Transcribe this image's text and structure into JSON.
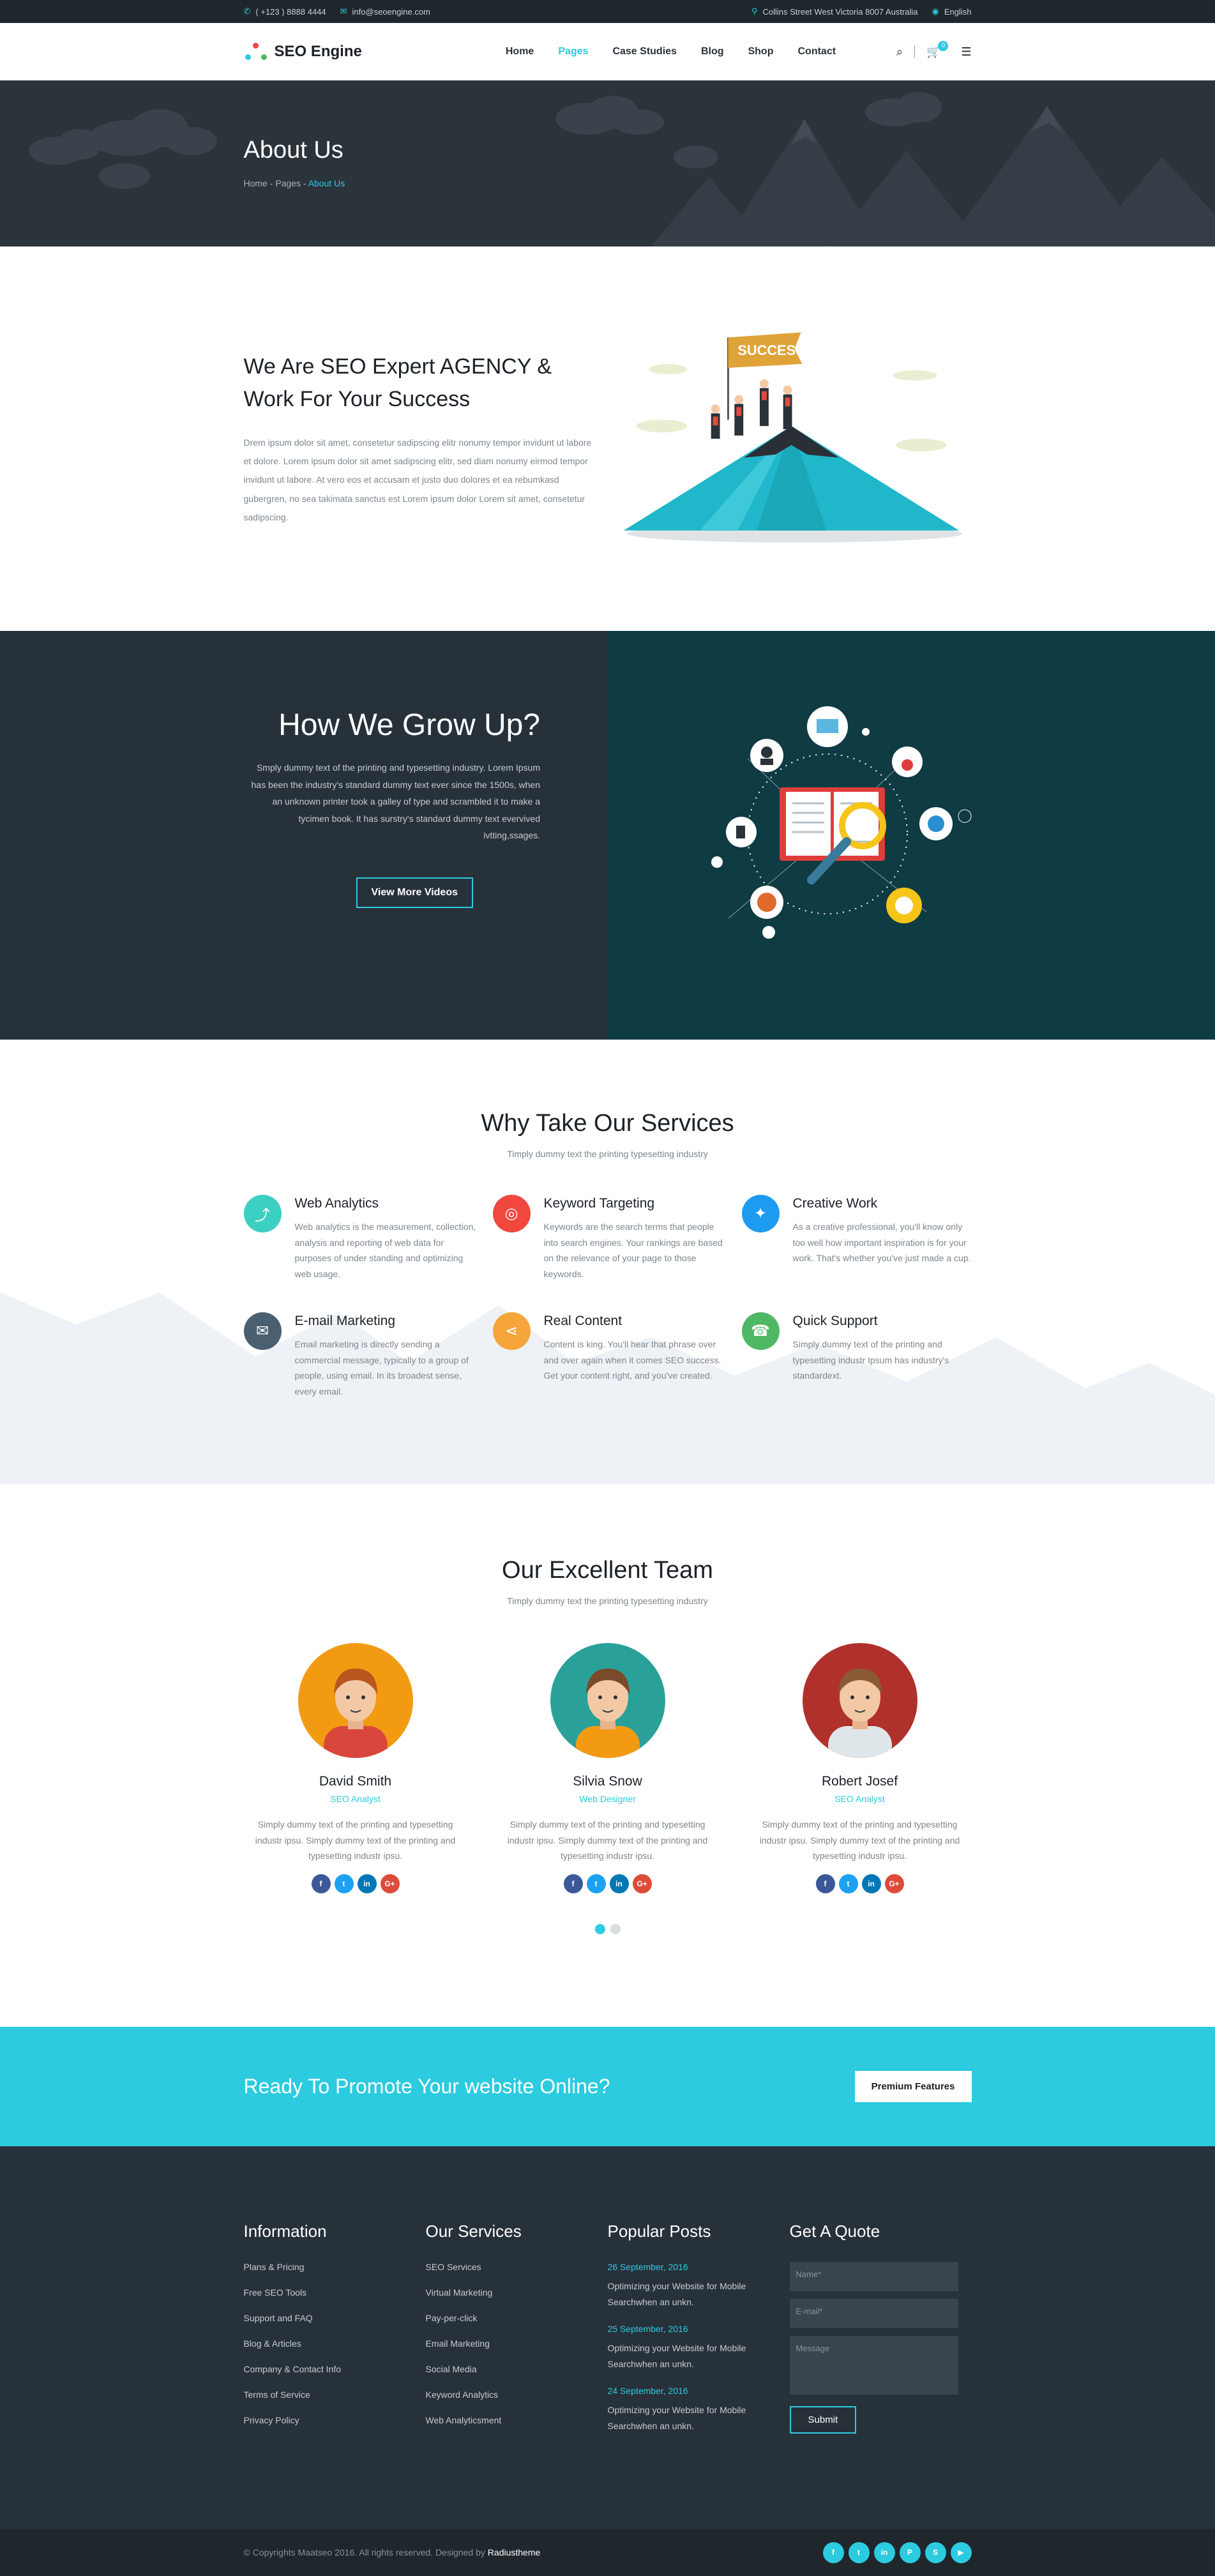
{
  "topbar": {
    "phone": "( +123 ) 8888 4444",
    "email": "info@seoengine.com",
    "address": "Collins Street West Victoria 8007 Australia",
    "language": "English"
  },
  "header": {
    "logo": "SEO Engine",
    "nav": [
      "Home",
      "Pages",
      "Case Studies",
      "Blog",
      "Shop",
      "Contact"
    ],
    "active": "Pages",
    "cart_count": "0"
  },
  "banner": {
    "title": "About Us",
    "crumbs": [
      "Home",
      "Pages",
      "About Us"
    ]
  },
  "about": {
    "heading": "We Are SEO Expert AGENCY & Work For Your Success",
    "body": "Drem ipsum dolor sit amet, consetetur sadipscing elitr nonumy tempor invidunt ut labore et dolore. Lorem ipsum dolor sit amet sadipscing elitr, sed diam nonumy eirmod tempor invidunt ut labore. At vero eos et accusam et justo duo dolores et ea rebumkasd gubergren, no sea takimata sanctus est Lorem ipsum dolor Lorem sit amet, consetetur sadipscing.",
    "flag_text": "SUCCESS"
  },
  "grow": {
    "heading": "How We Grow Up?",
    "body": "Smply dummy text of the printing and typesetting industry. Lorem Ipsum has been the industry's standard dummy text ever since the 1500s, when an unknown printer took a galley of type and scrambled it to make a tycimen book. It has surstry's standard dummy text evervived ivtting,ssages.",
    "button": "View More Videos"
  },
  "services": {
    "title": "Why Take Our Services",
    "subtitle": "Timply dummy text the printing typesetting industry",
    "items": [
      {
        "title": "Web Analytics",
        "text": "Web analytics is the measurement, collection, analysis and reporting of web data for purposes of under standing and optimizing web usage.",
        "color": "#3ccfc3",
        "icon": "analytics-icon",
        "glyph": "⤴"
      },
      {
        "title": "Keyword Targeting",
        "text": "Keywords are the search terms that people into search engines. Your rankings are based on the relevance of your page to those keywords.",
        "color": "#f0473f",
        "icon": "target-icon",
        "glyph": "◎"
      },
      {
        "title": "Creative Work",
        "text": "As a creative professional, you'll know only too well how important inspiration is for your work. That's whether you've just made a cup.",
        "color": "#1c9bf0",
        "icon": "lightbulb-icon",
        "glyph": "✦"
      },
      {
        "title": "E-mail Marketing",
        "text": "Email marketing is directly sending a commercial message, typically to a group of people, using email. In its broadest sense, every email.",
        "color": "#4a6070",
        "icon": "envelope-icon",
        "glyph": "✉"
      },
      {
        "title": "Real Content",
        "text": "Content is king. You'll hear that phrase over and over again when it comes SEO success. Get your content right, and you've created.",
        "color": "#f6a53a",
        "icon": "share-icon",
        "glyph": "⋖"
      },
      {
        "title": "Quick Support",
        "text": "Simply dummy text of the printing and typesetting industr Ipsum has industry's standardext.",
        "color": "#4fb865",
        "icon": "headset-icon",
        "glyph": "☎"
      }
    ]
  },
  "team": {
    "title": "Our Excellent Team",
    "subtitle": "Timply dummy text the printing typesetting industry",
    "members": [
      {
        "name": "David Smith",
        "role": "SEO Analyst",
        "bio": "Simply dummy text of the printing and typesetting industr ipsu. Simply dummy text of the printing and typesetting industr ipsu.",
        "bg": "#f29b12",
        "hair": "#b8561f",
        "shirt": "#d9463d"
      },
      {
        "name": "Silvia Snow",
        "role": "Web Designer",
        "bio": "Simply dummy text of the printing and typesetting industr ipsu. Simply dummy text of the printing and typesetting industr ipsu.",
        "bg": "#2aa198",
        "hair": "#7a4a2a",
        "shirt": "#f29b12"
      },
      {
        "name": "Robert Josef",
        "role": "SEO Analyst",
        "bio": "Simply dummy text of the printing and typesetting industr ipsu. Simply dummy text of the printing and typesetting industr ipsu.",
        "bg": "#b0302c",
        "hair": "#8a5a35",
        "shirt": "#dfe6ea"
      }
    ],
    "social": [
      {
        "label": "f",
        "color": "#3b5998",
        "icon": "facebook-icon"
      },
      {
        "label": "t",
        "color": "#1da1f2",
        "icon": "twitter-icon"
      },
      {
        "label": "in",
        "color": "#0077b5",
        "icon": "linkedin-icon"
      },
      {
        "label": "G+",
        "color": "#dd4b39",
        "icon": "google-plus-icon"
      }
    ]
  },
  "cta": {
    "text": "Ready To Promote Your website Online?",
    "button": "Premium Features"
  },
  "footer": {
    "info_title": "Information",
    "info_links": [
      "Plans & Pricing",
      "Free SEO Tools",
      "Support and FAQ",
      "Blog & Articles",
      "Company & Contact Info",
      "Terms of Service",
      "Privacy Policy"
    ],
    "services_title": "Our Services",
    "services_links": [
      "SEO Services",
      "Virtual Marketing",
      "Pay-per-click",
      "Email Marketing",
      "Social Media",
      "Keyword Analytics",
      "Web Analyticsment"
    ],
    "posts_title": "Popular Posts",
    "posts": [
      {
        "date": "26 September, 2016",
        "title": "Optimizing your Website for Mobile Searchwhen an unkn."
      },
      {
        "date": "25 September, 2016",
        "title": "Optimizing your Website for Mobile Searchwhen an unkn."
      },
      {
        "date": "24 September, 2016",
        "title": "Optimizing your Website for Mobile Searchwhen an unkn."
      }
    ],
    "quote_title": "Get A Quote",
    "name_ph": "Name*",
    "email_ph": "E-mail*",
    "message_ph": "Message",
    "submit": "Submit"
  },
  "bottom": {
    "copyright": "© Copyrights Maatseo 2016. All rights reserved. Designed by",
    "designer": "Radiustheme",
    "social": [
      "f",
      "t",
      "in",
      "P",
      "S",
      "▶"
    ]
  }
}
